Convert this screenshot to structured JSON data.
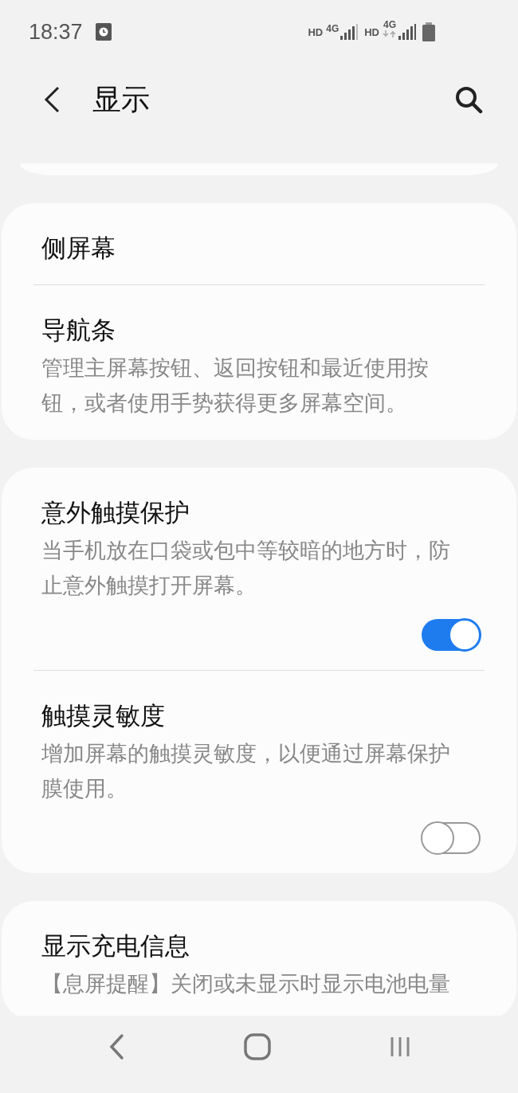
{
  "status_bar": {
    "time": "18:37",
    "sims": [
      {
        "hd": "HD",
        "network": "4G",
        "data_arrows": false
      },
      {
        "hd": "HD",
        "network": "4G",
        "data_arrows": true
      }
    ]
  },
  "header": {
    "title": "显示"
  },
  "cards": [
    {
      "items": [
        {
          "kind": "link",
          "title": "侧屏幕"
        },
        {
          "kind": "link",
          "title": "导航条",
          "description": "管理主屏幕按钮、返回按钮和最近使用按钮，或者使用手势获得更多屏幕空间。"
        }
      ]
    },
    {
      "items": [
        {
          "kind": "toggle",
          "title": "意外触摸保护",
          "description": "当手机放在口袋或包中等较暗的地方时，防止意外触摸打开屏幕。",
          "on": true
        },
        {
          "kind": "toggle",
          "title": "触摸灵敏度",
          "description": "增加屏幕的触摸灵敏度，以便通过屏幕保护膜使用。",
          "on": false
        }
      ]
    },
    {
      "items": [
        {
          "kind": "link",
          "title": "显示充电信息",
          "description": "【息屏提醒】关闭或未显示时显示电池电量"
        }
      ]
    }
  ]
}
